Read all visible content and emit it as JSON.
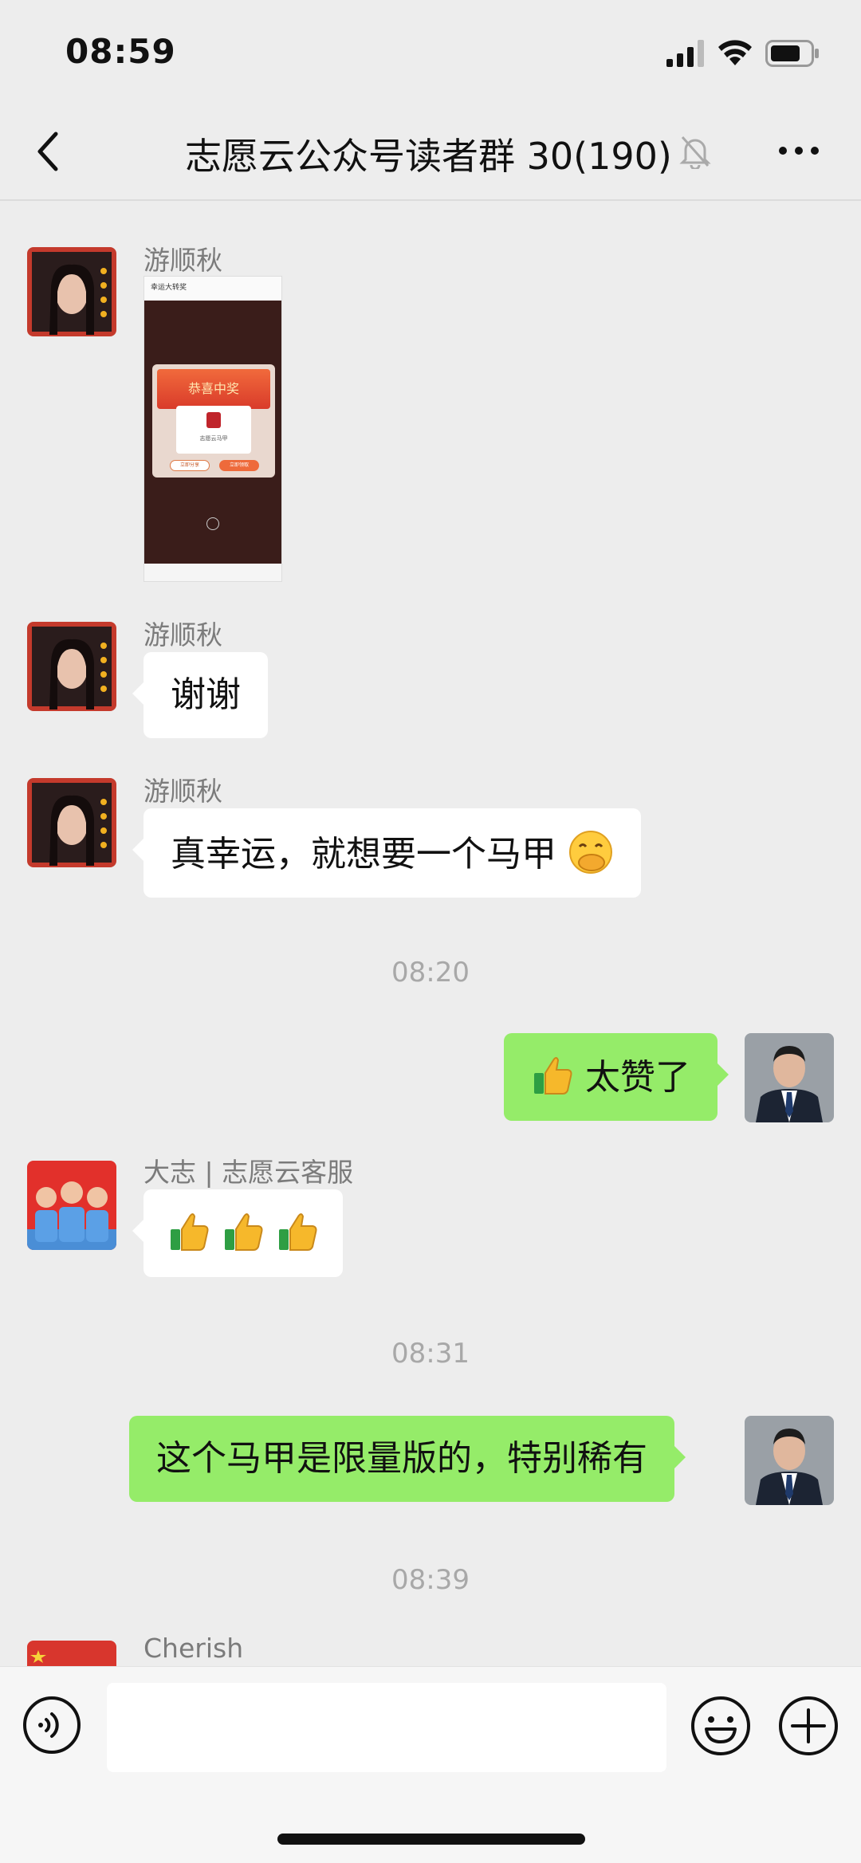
{
  "status_bar": {
    "time": "08:59"
  },
  "header": {
    "title": "志愿云公众号读者群 30(190)",
    "icons": [
      "back-icon",
      "mute-icon",
      "more-icon"
    ]
  },
  "messages": [
    {
      "sender": "游顺秋",
      "type": "image",
      "image": {
        "header": "幸运大转奖",
        "popup_title": "恭喜中奖",
        "card_text": "志愿云马甲",
        "btn_share": "立即分享",
        "btn_claim": "立即领取"
      }
    },
    {
      "sender": "游顺秋",
      "type": "text",
      "text": "谢谢"
    },
    {
      "sender": "游顺秋",
      "type": "text",
      "text": "真幸运，就想要一个马甲",
      "emoji": "face-with-hand-over-mouth"
    },
    {
      "type": "time",
      "text": "08:20"
    },
    {
      "sender": "me",
      "type": "text",
      "text": "太赞了",
      "emoji": "thumbs-up"
    },
    {
      "sender": "大志 | 志愿云客服",
      "type": "emoji",
      "emoji": [
        "thumbs-up",
        "thumbs-up",
        "thumbs-up"
      ]
    },
    {
      "type": "time",
      "text": "08:31"
    },
    {
      "sender": "me",
      "type": "text",
      "text": "这个马甲是限量版的，特别稀有"
    },
    {
      "type": "time",
      "text": "08:39"
    },
    {
      "sender": "Cherish",
      "type": "partial"
    }
  ],
  "input_bar": {
    "placeholder": "",
    "icons": [
      "voice-icon",
      "emoji-icon",
      "add-icon"
    ]
  },
  "colors": {
    "background": "#ededed",
    "bubble_mine": "#95ec69",
    "bubble_other": "#ffffff"
  }
}
